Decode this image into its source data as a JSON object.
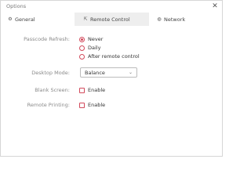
{
  "window": {
    "title": "Options",
    "close_glyph": "✕"
  },
  "tabs": [
    {
      "label": "General",
      "icon": "gear-icon",
      "glyph": "⚙"
    },
    {
      "label": "Remote Control",
      "icon": "remote-control-icon",
      "glyph": "⇱",
      "selected": true
    },
    {
      "label": "Network",
      "icon": "network-icon",
      "glyph": "◍"
    }
  ],
  "passcode_refresh": {
    "label": "Passcode Refresh:",
    "options": [
      "Never",
      "Daily",
      "After remote control"
    ],
    "selected": "Never"
  },
  "desktop_mode": {
    "label": "Desktop Mode:",
    "value": "Balance",
    "chevron": "⌄"
  },
  "blank_screen": {
    "label": "Blank Screen:",
    "checkbox_label": "Enable",
    "checked": false
  },
  "remote_printing": {
    "label": "Remote Printing:",
    "checkbox_label": "Enable",
    "checked": false
  },
  "colors": {
    "accent": "#d2495b",
    "tab_selected_bg": "#eeeeee",
    "label_gray": "#8a8a8a"
  }
}
